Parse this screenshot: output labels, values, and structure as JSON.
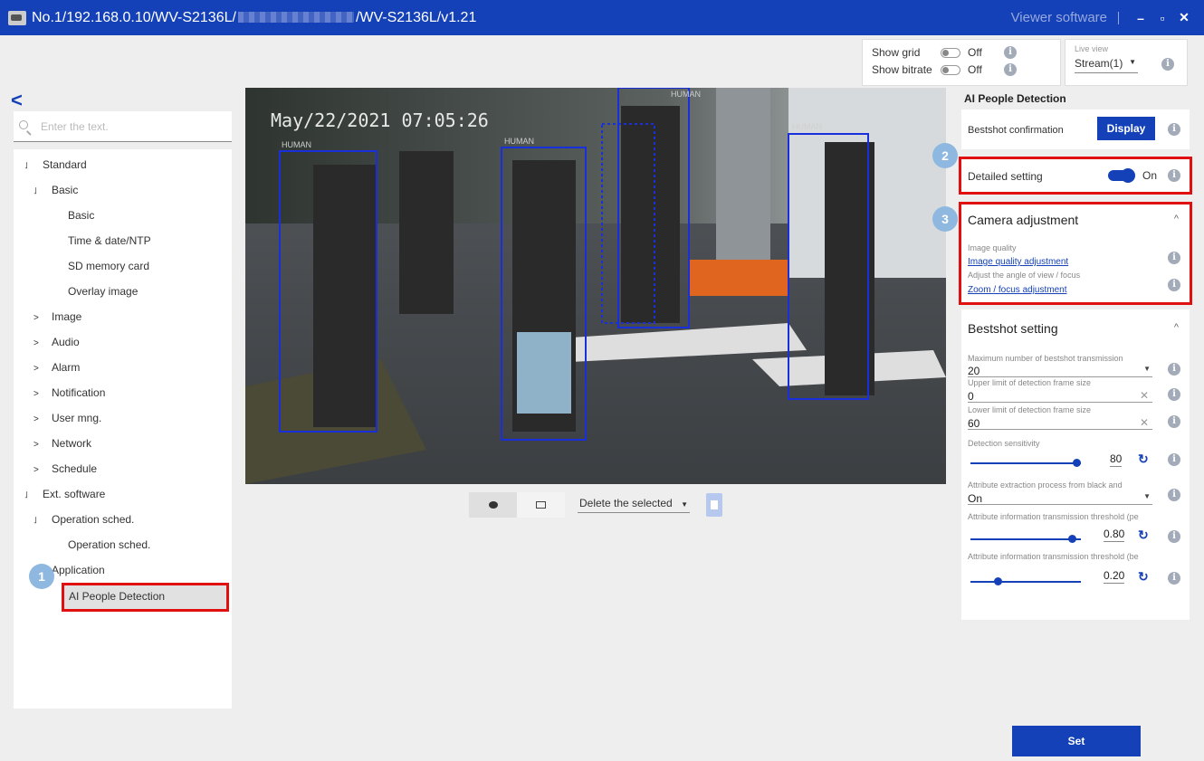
{
  "titlebar": {
    "title_prefix": "No.1/192.168.0.10/WV-S2136L/",
    "title_suffix": "/WV-S2136L/v1.21",
    "viewer": "Viewer software",
    "minimize": "–",
    "maximize": "▫",
    "close": "✕"
  },
  "topbar": {
    "show_grid": "Show grid",
    "show_grid_value": "Off",
    "show_bitrate": "Show bitrate",
    "show_bitrate_value": "Off",
    "live_view": "Live view",
    "stream": "Stream(1)"
  },
  "left": {
    "back": "<",
    "search_placeholder": "Enter the text.",
    "tree": [
      {
        "label": "Standard",
        "arrow": "˩"
      },
      {
        "label": "Basic",
        "arrow": "˩"
      },
      {
        "label": "Basic",
        "arrow": ""
      },
      {
        "label": "Time & date/NTP",
        "arrow": ""
      },
      {
        "label": "SD memory card",
        "arrow": ""
      },
      {
        "label": "Overlay image",
        "arrow": ""
      },
      {
        "label": "Image",
        "arrow": ">"
      },
      {
        "label": "Audio",
        "arrow": ">"
      },
      {
        "label": "Alarm",
        "arrow": ">"
      },
      {
        "label": "Notification",
        "arrow": ">"
      },
      {
        "label": "User mng.",
        "arrow": ">"
      },
      {
        "label": "Network",
        "arrow": ">"
      },
      {
        "label": "Schedule",
        "arrow": ">"
      },
      {
        "label": "Ext. software",
        "arrow": "˩"
      },
      {
        "label": "Operation sched.",
        "arrow": "˩"
      },
      {
        "label": "Operation sched.",
        "arrow": ""
      },
      {
        "label": "Application",
        "arrow": "˩"
      },
      {
        "label": "AI People Detection",
        "arrow": ""
      }
    ],
    "badge": "1"
  },
  "camera": {
    "timestamp": "May/22/2021 07:05:26",
    "box_label": "HUMAN"
  },
  "camtoolbar": {
    "delete_selected": "Delete the selected"
  },
  "right": {
    "title": "AI People Detection",
    "bestshot_confirmation": "Bestshot confirmation",
    "display": "Display",
    "detailed_setting": "Detailed setting",
    "detailed_value": "On",
    "badge2": "2",
    "badge3": "3",
    "camera_adjustment": "Camera adjustment",
    "image_quality": "Image quality",
    "image_quality_link": "Image quality adjustment",
    "angle_text": "Adjust the angle of view / focus",
    "zoom_link": "Zoom / focus adjustment",
    "bestshot_setting": "Bestshot setting",
    "max_bestshot_label": "Maximum number of bestshot transmission",
    "max_bestshot_value": "20",
    "upper_limit_label": "Upper limit of detection frame size",
    "upper_limit_value": "0",
    "lower_limit_label": "Lower limit of detection frame size",
    "lower_limit_value": "60",
    "sensitivity_label": "Detection sensitivity",
    "sensitivity_value": "80",
    "attr_extract_label": "Attribute extraction process from black and",
    "attr_extract_value": "On",
    "attr_thresh_pe_label": "Attribute information transmission threshold (pe",
    "attr_thresh_pe_value": "0.80",
    "attr_thresh_be_label": "Attribute information transmission threshold (be",
    "attr_thresh_be_value": "0.20",
    "set": "Set"
  },
  "colors": {
    "accent": "#1441b8",
    "highlight": "#e01010",
    "badge": "#8fb8e0"
  }
}
